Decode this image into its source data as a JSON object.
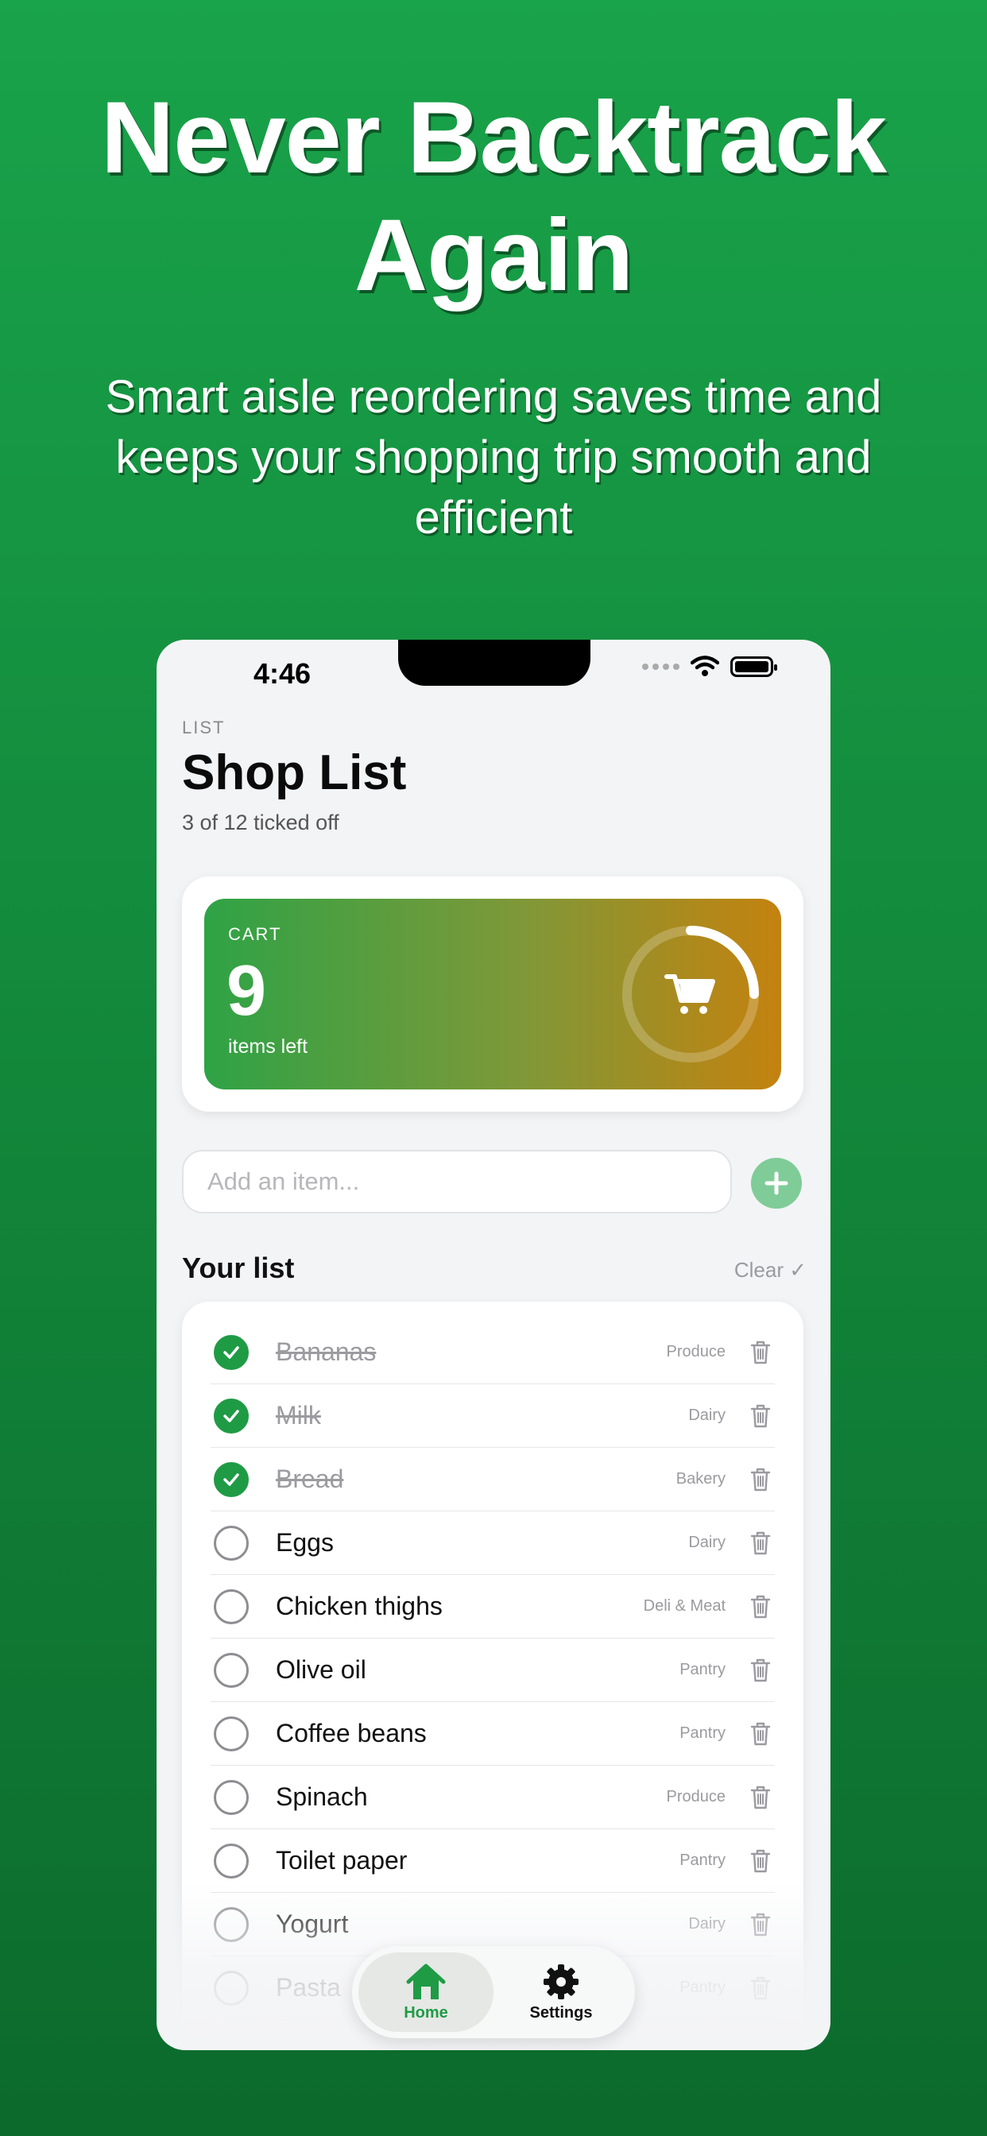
{
  "promo": {
    "headline": "Never Backtrack Again",
    "subline": "Smart aisle reordering saves time and keeps your shopping trip smooth and efficient"
  },
  "status_bar": {
    "time": "4:46"
  },
  "header": {
    "eyebrow": "LIST",
    "title": "Shop List",
    "subtitle": "3 of 12 ticked off"
  },
  "cart": {
    "label": "CART",
    "count": "9",
    "sub": "items left",
    "progress": 0.25,
    "gradient": [
      "#2ea346",
      "#c4820f"
    ]
  },
  "add_item": {
    "placeholder": "Add an item..."
  },
  "list": {
    "title": "Your list",
    "clear_label": "Clear ✓",
    "items": [
      {
        "name": "Bananas",
        "category": "Produce",
        "done": true
      },
      {
        "name": "Milk",
        "category": "Dairy",
        "done": true
      },
      {
        "name": "Bread",
        "category": "Bakery",
        "done": true
      },
      {
        "name": "Eggs",
        "category": "Dairy",
        "done": false
      },
      {
        "name": "Chicken thighs",
        "category": "Deli & Meat",
        "done": false
      },
      {
        "name": "Olive oil",
        "category": "Pantry",
        "done": false
      },
      {
        "name": "Coffee beans",
        "category": "Pantry",
        "done": false
      },
      {
        "name": "Spinach",
        "category": "Produce",
        "done": false
      },
      {
        "name": "Toilet paper",
        "category": "Pantry",
        "done": false
      },
      {
        "name": "Yogurt",
        "category": "Dairy",
        "done": false
      },
      {
        "name": "Pasta",
        "category": "Pantry",
        "done": false
      }
    ]
  },
  "tabbar": {
    "tabs": [
      {
        "label": "Home",
        "icon": "home-icon",
        "active": true
      },
      {
        "label": "Settings",
        "icon": "gear-icon",
        "active": false
      }
    ]
  },
  "colors": {
    "accent": "#1f9b45",
    "background": "#138a3c"
  }
}
